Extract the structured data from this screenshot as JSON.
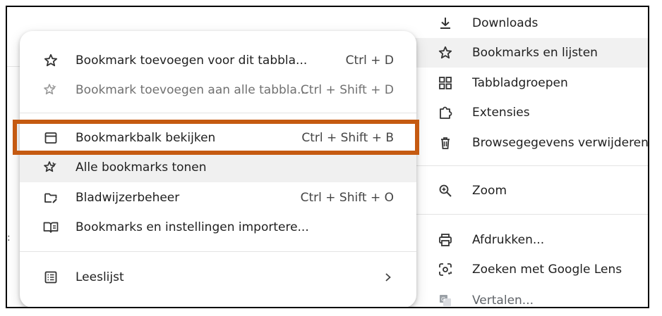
{
  "right_menu": {
    "items": [
      {
        "label": "Downloads",
        "icon": "download-icon"
      },
      {
        "label": "Bookmarks en lijsten",
        "icon": "star-icon"
      },
      {
        "label": "Tabbladgroepen",
        "icon": "tab-groups-icon"
      },
      {
        "label": "Extensies",
        "icon": "puzzle-icon"
      },
      {
        "label": "Browsegegevens verwijderen...",
        "icon": "trash-icon"
      },
      {
        "label": "Zoom",
        "icon": "zoom-icon"
      },
      {
        "label": "Afdrukken...",
        "icon": "printer-icon"
      },
      {
        "label": "Zoeken met Google Lens",
        "icon": "lens-icon"
      },
      {
        "label": "Vertalen...",
        "icon": "translate-icon"
      }
    ]
  },
  "bookmarks_menu": {
    "items": [
      {
        "label": "Bookmark toevoegen voor dit tabbla...",
        "shortcut": "Ctrl + D",
        "icon": "star-outline-icon"
      },
      {
        "label": "Bookmark toevoegen aan alle tabbla...",
        "shortcut": "Ctrl + Shift + D",
        "icon": "stars-icon"
      },
      {
        "label": "Bookmarkbalk bekijken",
        "shortcut": "Ctrl + Shift + B",
        "icon": "bookmark-bar-icon"
      },
      {
        "label": "Alle bookmarks tonen",
        "shortcut": "",
        "icon": "stars-icon"
      },
      {
        "label": "Bladwijzerbeheer",
        "shortcut": "Ctrl + Shift + O",
        "icon": "folder-edit-icon"
      },
      {
        "label": "Bookmarks en instellingen importere...",
        "shortcut": "",
        "icon": "book-icon"
      },
      {
        "label": "Leeslijst",
        "shortcut": "",
        "icon": "reading-list-icon"
      }
    ]
  },
  "colors": {
    "highlight_box": "#c55a11"
  }
}
